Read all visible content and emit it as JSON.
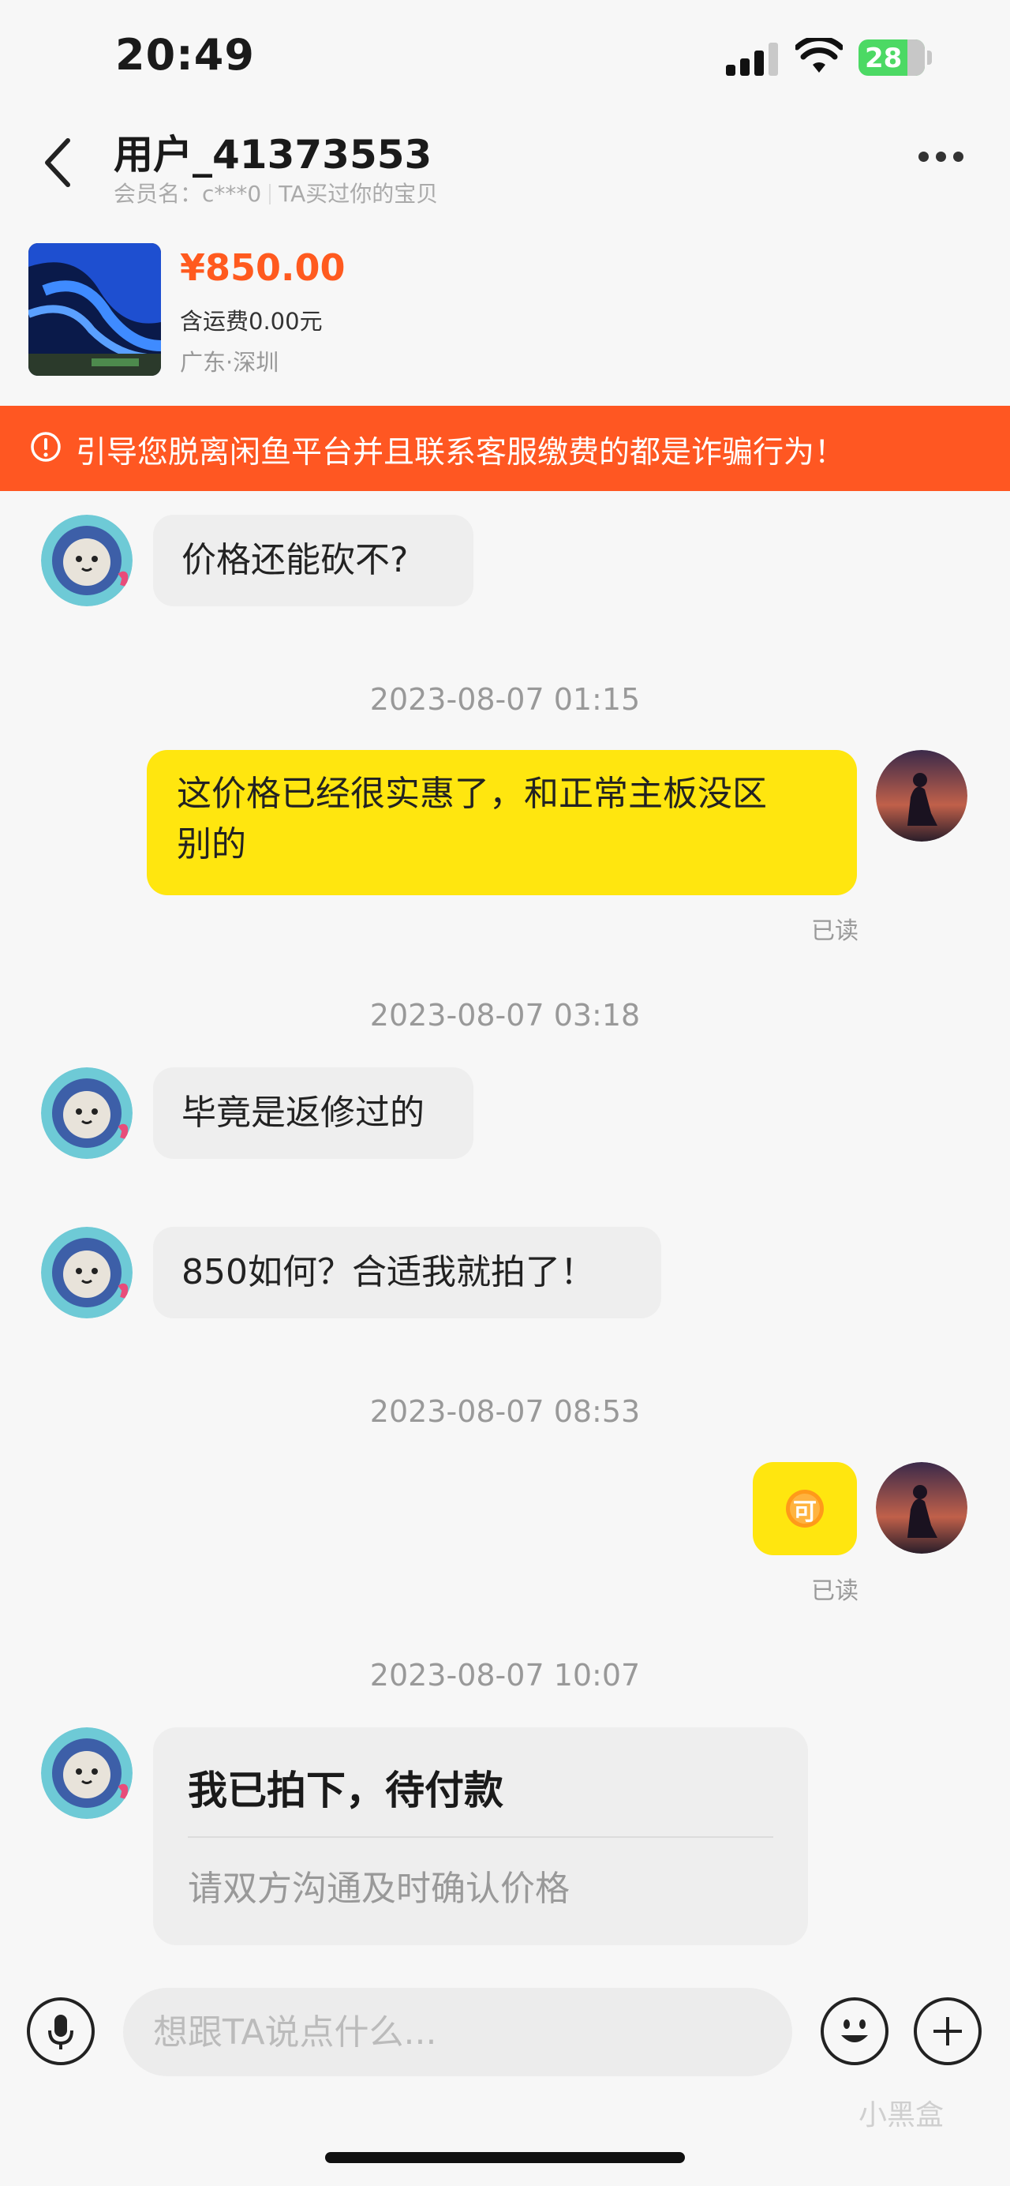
{
  "status_bar": {
    "time": "20:49",
    "battery": "28"
  },
  "header": {
    "title": "用户_41373553",
    "member_label": "会员名：c***0",
    "relation": "TA买过你的宝贝",
    "back_icon": "chevron-left-icon",
    "more_icon": "more-dots-icon"
  },
  "product": {
    "price": "¥850.00",
    "shipping": "含运费0.00元",
    "location": "广东·深圳"
  },
  "warning": {
    "text": "引导您脱离闲鱼平台并且联系客服缴费的都是诈骗行为！",
    "color": "#ff5722"
  },
  "messages": {
    "m1": "价格还能砍不?",
    "ts1": "2023-08-07 01:15",
    "m2_line1": "这价格已经很实惠了，和正常主板没区",
    "m2_line2": "别的",
    "read1": "已读",
    "ts2": "2023-08-07 03:18",
    "m3": "毕竟是返修过的",
    "m4": "850如何？合适我就拍了！",
    "ts3": "2023-08-07 08:53",
    "m5_sticker": "可",
    "read2": "已读",
    "ts4": "2023-08-07 10:07",
    "card_title": "我已拍下，待付款",
    "card_sub": "请双方沟通及时确认价格"
  },
  "input_bar": {
    "placeholder": "想跟TA说点什么...",
    "mic_icon": "microphone-icon",
    "emoji_icon": "emoji-icon",
    "plus_icon": "plus-icon"
  },
  "watermark": "小黑盒",
  "colors": {
    "accent_yellow": "#ffe60f",
    "price_orange": "#ff5a1f",
    "banner_orange": "#ff5722"
  }
}
